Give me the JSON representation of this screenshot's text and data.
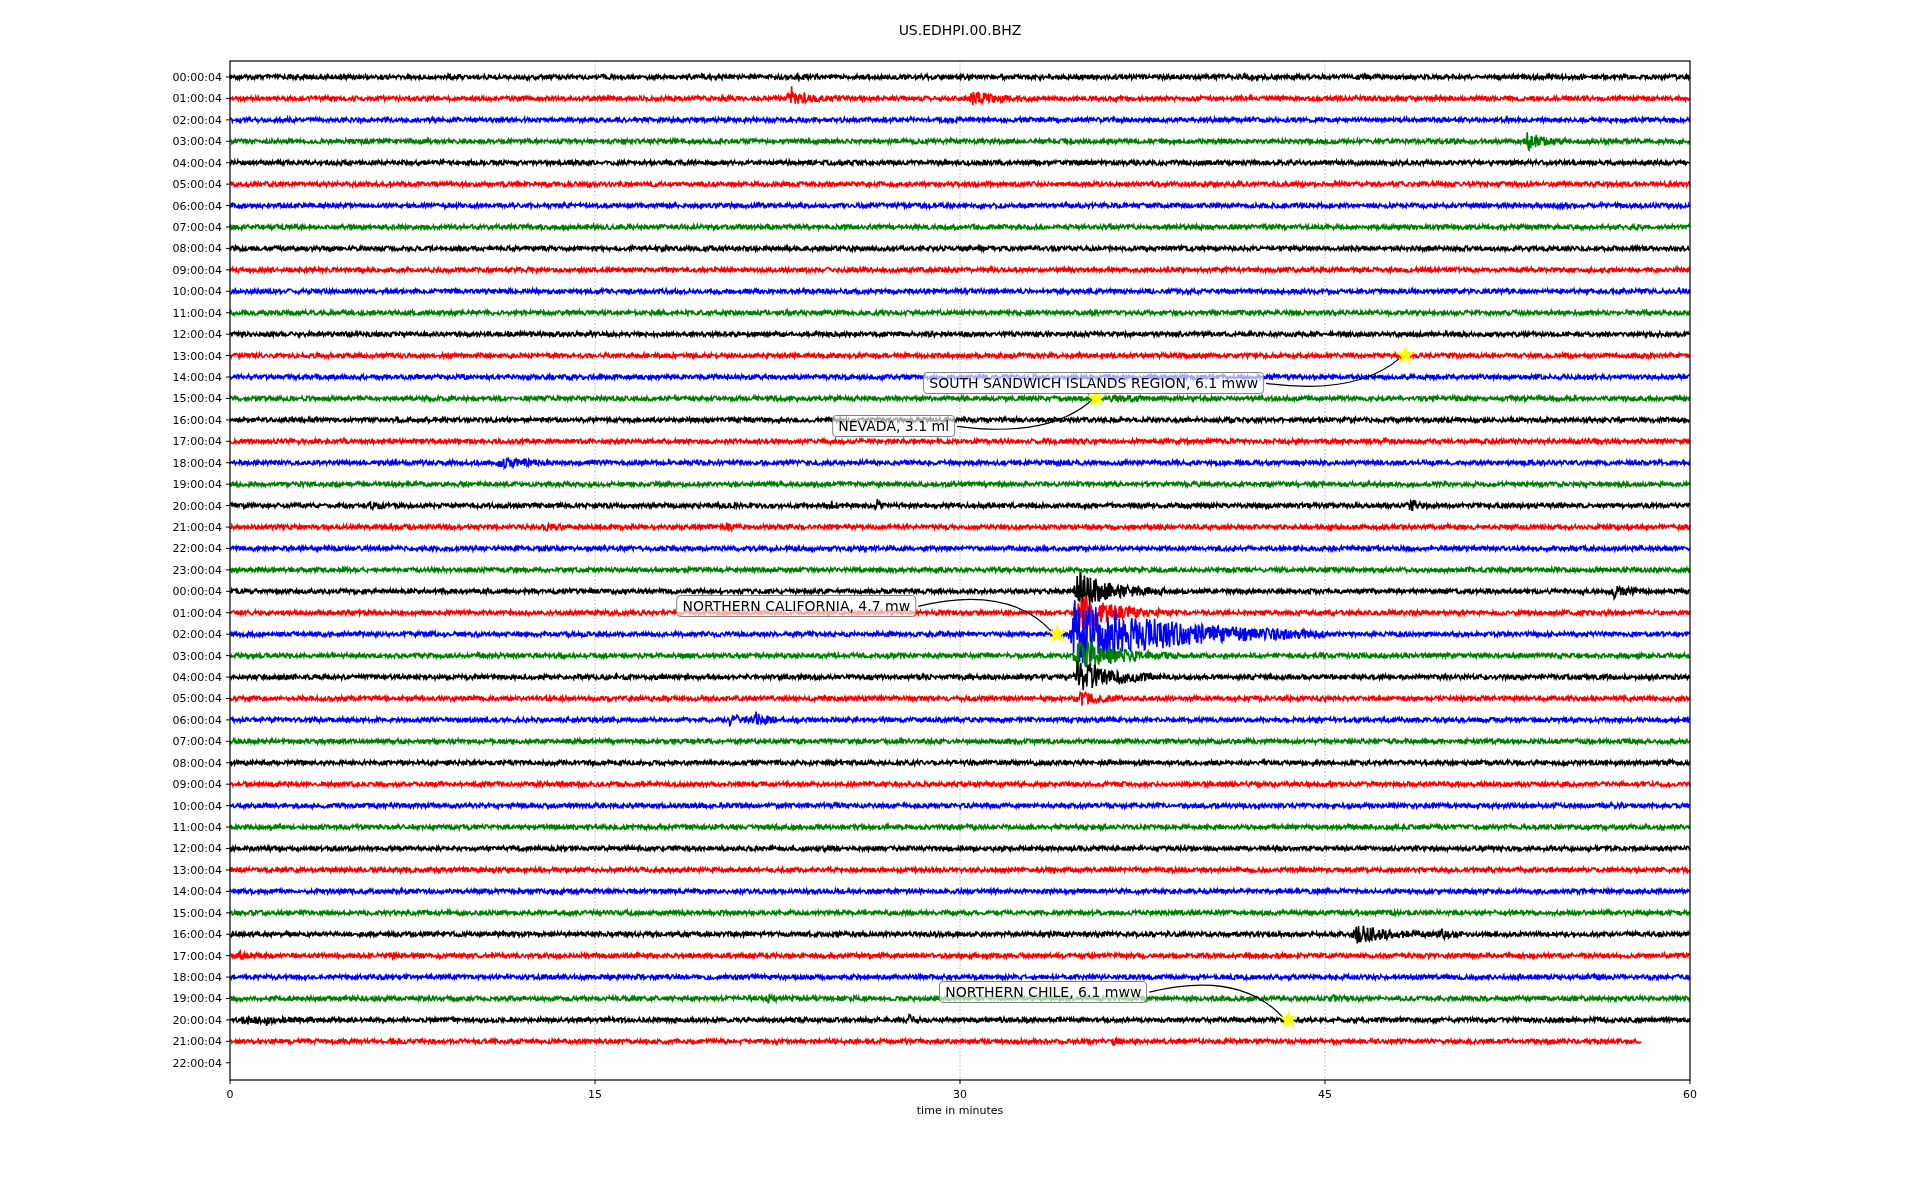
{
  "title": "US.EDHPI.00.BHZ",
  "chart": {
    "rows": [
      {
        "label": "00:00:04",
        "color": "#000000",
        "kind": "full"
      },
      {
        "label": "01:00:04",
        "color": "#ff0000",
        "kind": "full"
      },
      {
        "label": "02:00:04",
        "color": "#0000ff",
        "kind": "full"
      },
      {
        "label": "03:00:04",
        "color": "#008000",
        "kind": "full"
      },
      {
        "label": "04:00:04",
        "color": "#000000",
        "kind": "full"
      },
      {
        "label": "05:00:04",
        "color": "#ff0000",
        "kind": "full"
      },
      {
        "label": "06:00:04",
        "color": "#0000ff",
        "kind": "full"
      },
      {
        "label": "07:00:04",
        "color": "#008000",
        "kind": "full"
      },
      {
        "label": "08:00:04",
        "color": "#000000",
        "kind": "full"
      },
      {
        "label": "09:00:04",
        "color": "#ff0000",
        "kind": "full"
      },
      {
        "label": "10:00:04",
        "color": "#0000ff",
        "kind": "full"
      },
      {
        "label": "11:00:04",
        "color": "#008000",
        "kind": "full"
      },
      {
        "label": "12:00:04",
        "color": "#000000",
        "kind": "full"
      },
      {
        "label": "13:00:04",
        "color": "#ff0000",
        "kind": "full"
      },
      {
        "label": "14:00:04",
        "color": "#0000ff",
        "kind": "full"
      },
      {
        "label": "15:00:04",
        "color": "#008000",
        "kind": "full"
      },
      {
        "label": "16:00:04",
        "color": "#000000",
        "kind": "full"
      },
      {
        "label": "17:00:04",
        "color": "#ff0000",
        "kind": "full"
      },
      {
        "label": "18:00:04",
        "color": "#0000ff",
        "kind": "full"
      },
      {
        "label": "19:00:04",
        "color": "#008000",
        "kind": "full"
      },
      {
        "label": "20:00:04",
        "color": "#000000",
        "kind": "full"
      },
      {
        "label": "21:00:04",
        "color": "#ff0000",
        "kind": "full"
      },
      {
        "label": "22:00:04",
        "color": "#0000ff",
        "kind": "full"
      },
      {
        "label": "23:00:04",
        "color": "#008000",
        "kind": "full"
      },
      {
        "label": "00:00:04",
        "color": "#000000",
        "kind": "full"
      },
      {
        "label": "01:00:04",
        "color": "#ff0000",
        "kind": "full"
      },
      {
        "label": "02:00:04",
        "color": "#0000ff",
        "kind": "full"
      },
      {
        "label": "03:00:04",
        "color": "#008000",
        "kind": "full"
      },
      {
        "label": "04:00:04",
        "color": "#000000",
        "kind": "full"
      },
      {
        "label": "05:00:04",
        "color": "#ff0000",
        "kind": "full"
      },
      {
        "label": "06:00:04",
        "color": "#0000ff",
        "kind": "full"
      },
      {
        "label": "07:00:04",
        "color": "#008000",
        "kind": "full"
      },
      {
        "label": "08:00:04",
        "color": "#000000",
        "kind": "full"
      },
      {
        "label": "09:00:04",
        "color": "#ff0000",
        "kind": "full"
      },
      {
        "label": "10:00:04",
        "color": "#0000ff",
        "kind": "full"
      },
      {
        "label": "11:00:04",
        "color": "#008000",
        "kind": "full"
      },
      {
        "label": "12:00:04",
        "color": "#000000",
        "kind": "full"
      },
      {
        "label": "13:00:04",
        "color": "#ff0000",
        "kind": "full"
      },
      {
        "label": "14:00:04",
        "color": "#0000ff",
        "kind": "full"
      },
      {
        "label": "15:00:04",
        "color": "#008000",
        "kind": "full"
      },
      {
        "label": "16:00:04",
        "color": "#000000",
        "kind": "full"
      },
      {
        "label": "17:00:04",
        "color": "#ff0000",
        "kind": "full"
      },
      {
        "label": "18:00:04",
        "color": "#0000ff",
        "kind": "full"
      },
      {
        "label": "19:00:04",
        "color": "#008000",
        "kind": "full"
      },
      {
        "label": "20:00:04",
        "color": "#000000",
        "kind": "full"
      },
      {
        "label": "21:00:04",
        "color": "#ff0000",
        "kind": "partial"
      },
      {
        "label": "22:00:04",
        "kind": "none"
      }
    ],
    "xticks": [
      "0",
      "15",
      "30",
      "45",
      "60"
    ],
    "xlabel": "time in minutes",
    "events": [
      {
        "text": "SOUTH SANDWICH ISLANDS REGION, 6.1 mww"
      },
      {
        "text": "NEVADA, 3.1 ml"
      },
      {
        "text": "NORTHERN CALIFORNIA, 4.7 mw"
      },
      {
        "text": "NORTHERN CHILE, 6.1 mww"
      }
    ]
  }
}
